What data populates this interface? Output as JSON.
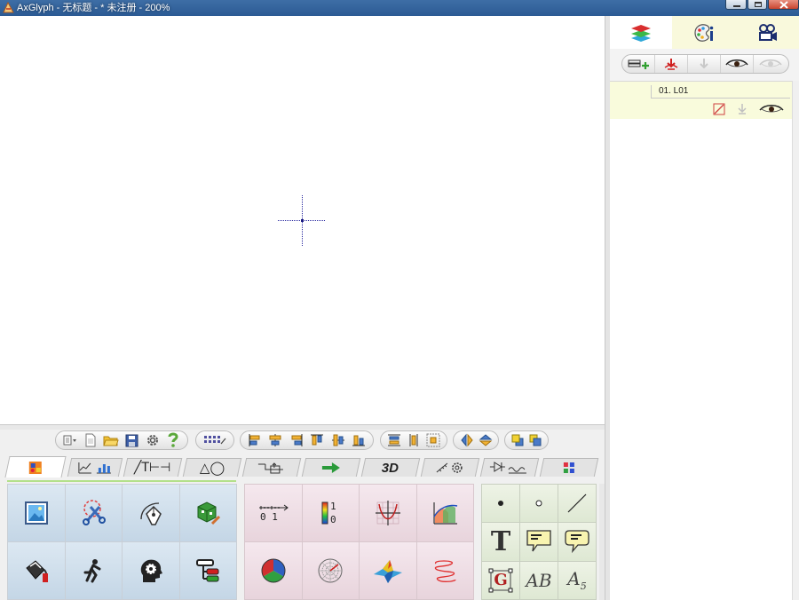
{
  "window": {
    "title": "AxGlyph - 无标题 - * 未注册 - 200%"
  },
  "right_panel": {
    "tabs": [
      {
        "icon": "layers-icon"
      },
      {
        "icon": "palette-info-icon"
      },
      {
        "icon": "movie-camera-icon"
      }
    ],
    "layer_tools": [
      "add-layer-icon",
      "merge-down-icon",
      "move-down-icon",
      "show-all-icon",
      "hide-all-icon"
    ],
    "layers": [
      {
        "name": "01. L01",
        "icons": [
          "edit-layer-icon",
          "move-down-icon",
          "visible-eye-icon"
        ]
      }
    ]
  },
  "toolbar": {
    "groups": [
      [
        "view-menu-icon",
        "new-file-icon",
        "open-folder-icon",
        "save-icon",
        "settings-icon",
        "help-icon"
      ],
      [
        "grid-settings-icon"
      ],
      [
        "align-left-icon",
        "align-center-h-icon",
        "align-right-icon",
        "align-top-icon",
        "align-center-v-icon",
        "align-bottom-icon"
      ],
      [
        "same-height-icon",
        "distribute-v-icon",
        "distribute-icon"
      ],
      [
        "flip-h-icon",
        "flip-v-icon"
      ],
      [
        "bring-front-icon",
        "send-back-icon"
      ]
    ]
  },
  "tabs": [
    {
      "label": "",
      "icon": "palette-tab-icon",
      "active": true
    },
    {
      "label": "",
      "icon": "charts-tab-icon"
    },
    {
      "label": "╱T⊢⊣",
      "icon": "text-line-tab-icon"
    },
    {
      "label": "△◯",
      "icon": "shapes-tab-icon"
    },
    {
      "label": "",
      "icon": "connector-tab-icon"
    },
    {
      "label": "",
      "icon": "arrow-tab-icon"
    },
    {
      "label": "3D",
      "icon": "3d-tab-icon"
    },
    {
      "label": "",
      "icon": "physics-tab-icon"
    },
    {
      "label": "",
      "icon": "circuit-tab-icon"
    },
    {
      "label": "",
      "icon": "symbols-tab-icon"
    }
  ],
  "tool_grid_1": [
    "image-icon",
    "scissors-icon",
    "pen-tool-icon",
    "3d-box-icon",
    "paint-bucket-icon",
    "running-man-icon",
    "gear-head-icon",
    "hierarchy-icon"
  ],
  "tool_grid_2": [
    "number-axis-icon",
    "color-scale-icon",
    "function-plot-icon",
    "area-chart-icon",
    "pie-chart-icon",
    "polar-grid-icon",
    "3d-surface-icon",
    "helix-curve-icon"
  ],
  "tool_grid_3": [
    {
      "icon": "dot-icon"
    },
    {
      "icon": "small-circle-icon"
    },
    {
      "icon": "line-icon"
    },
    {
      "icon": "text-icon",
      "text": "T"
    },
    {
      "icon": "callout-rect-icon"
    },
    {
      "icon": "callout-round-icon"
    },
    {
      "icon": "glyph-frame-icon",
      "text": "G"
    },
    {
      "icon": "italic-text-icon",
      "text": "AB"
    },
    {
      "icon": "subscript-text-icon",
      "text": "A",
      "sub": "5"
    }
  ]
}
